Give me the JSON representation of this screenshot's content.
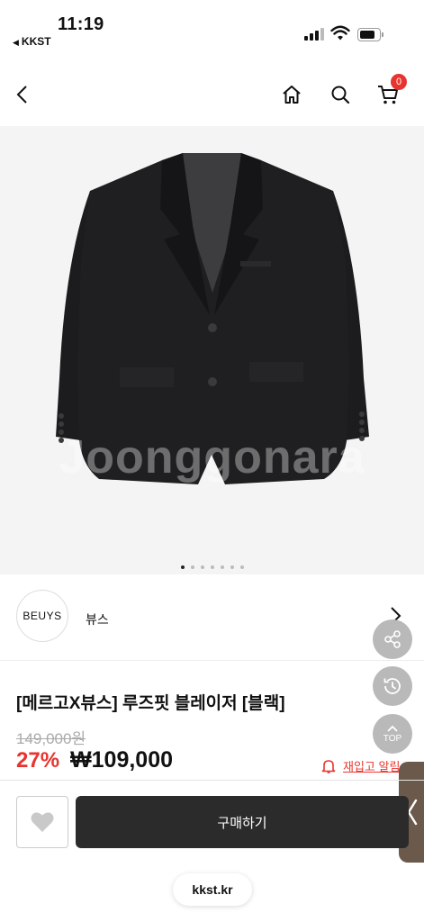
{
  "status_bar": {
    "time": "11:19",
    "back_app": "KKST",
    "back_icon": "back-triangle-icon"
  },
  "header": {
    "back_icon": "chevron-left-icon",
    "home_icon": "home-icon",
    "search_icon": "search-icon",
    "cart_icon": "cart-icon",
    "cart_count": "0"
  },
  "gallery": {
    "watermark": "Joonggonara",
    "total_images": 7,
    "active_index": 0
  },
  "brand": {
    "logo_text": "BEUYS",
    "name": "뷰스"
  },
  "product": {
    "title": "[메르고X뷰스] 루즈핏 블레이저 [블랙]",
    "original_price": "149,000원",
    "discount": "27%",
    "sale_price": "₩109,000"
  },
  "actions": {
    "restock_label": "재입고 알림",
    "buy_label": "구매하기",
    "top_label": "TOP"
  },
  "browser": {
    "url": "kkst.kr"
  },
  "colors": {
    "accent_red": "#e8342e",
    "buy_button": "#2b2b2b",
    "fab_gray": "#b9b9b9",
    "side_tab": "#6b5a4c"
  }
}
